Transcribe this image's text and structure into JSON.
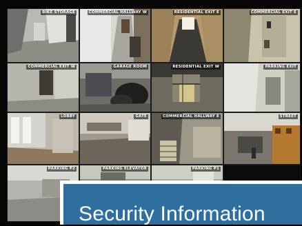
{
  "cameras": [
    {
      "label": "BIKE STORAGE"
    },
    {
      "label": "COMMERCIAL HALLWAY W"
    },
    {
      "label": "RESIDENTIAL EXIT E"
    },
    {
      "label": "COMMERCIAL EXIT E"
    },
    {
      "label": "COMMERCIAL EXIT W"
    },
    {
      "label": "GARAGE ROOM"
    },
    {
      "label": "RESIDENTIAL EXIT W"
    },
    {
      "label": "PARKING EXIT"
    },
    {
      "label": "LOBBY"
    },
    {
      "label": "GATE"
    },
    {
      "label": "COMMERCIAL HALLWAY E"
    },
    {
      "label": "STREET"
    },
    {
      "label": "PARKING P2"
    },
    {
      "label": "PARKING ELEVATOR"
    },
    {
      "label": "PARKING P1"
    }
  ],
  "banner": {
    "title": "Security Information"
  },
  "colors": {
    "banner_bg": "#2e6f9f",
    "banner_text": "#ffffff",
    "monitor_bg": "#050505"
  }
}
